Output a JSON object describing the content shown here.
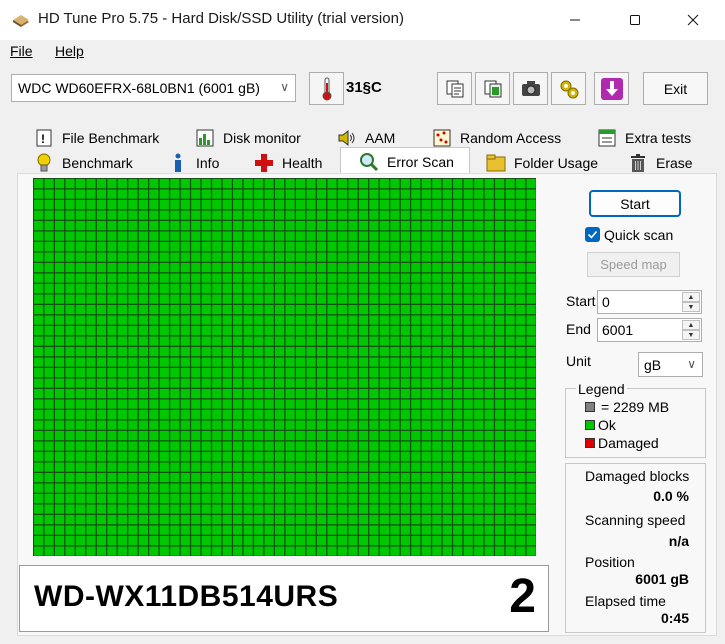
{
  "window": {
    "title": "HD Tune Pro 5.75 - Hard Disk/SSD Utility (trial version)"
  },
  "menu": {
    "file": "File",
    "help": "Help"
  },
  "toolbar": {
    "drive": "WDC WD60EFRX-68L0BN1 (6001 gB)",
    "temperature": "31§C",
    "exit_label": "Exit"
  },
  "tabs": {
    "row1": [
      "File Benchmark",
      "Disk monitor",
      "AAM",
      "Random Access",
      "Extra tests"
    ],
    "row2": [
      "Benchmark",
      "Info",
      "Health",
      "Error Scan",
      "Folder Usage",
      "Erase"
    ],
    "active": "Error Scan"
  },
  "scan": {
    "start_label": "Start",
    "quick_scan_label": "Quick scan",
    "quick_scan_checked": true,
    "speed_map_label": "Speed map",
    "start_field_label": "Start",
    "start_value": "0",
    "end_field_label": "End",
    "end_value": "6001",
    "unit_label": "Unit",
    "unit_value": "gB",
    "grid_cols": 48,
    "grid_rows": 36,
    "block_color_ok": "#00c800",
    "block_color_damaged": "#e00000",
    "block_color_unscanned": "#808080"
  },
  "legend": {
    "title": "Legend",
    "items": [
      {
        "label": "= 2289 MB",
        "color": "#808080"
      },
      {
        "label": "Ok",
        "color": "#00c800"
      },
      {
        "label": "Damaged",
        "color": "#e00000"
      }
    ]
  },
  "stats": {
    "damaged_blocks_label": "Damaged blocks",
    "damaged_blocks_value": "0.0 %",
    "scanning_speed_label": "Scanning speed",
    "scanning_speed_value": "n/a",
    "position_label": "Position",
    "position_value": "6001 gB",
    "elapsed_label": "Elapsed time",
    "elapsed_value": "0:45"
  },
  "drive_label": {
    "serial": "WD-WX11DB514URS",
    "number": "2"
  },
  "icons": {
    "app": "hard-disk-icon",
    "temperature": "thermometer-icon",
    "copy_text": "copy-text-icon",
    "copy_all": "copy-all-icon",
    "screenshot": "camera-icon",
    "options": "options-icon",
    "save": "save-download-icon"
  }
}
